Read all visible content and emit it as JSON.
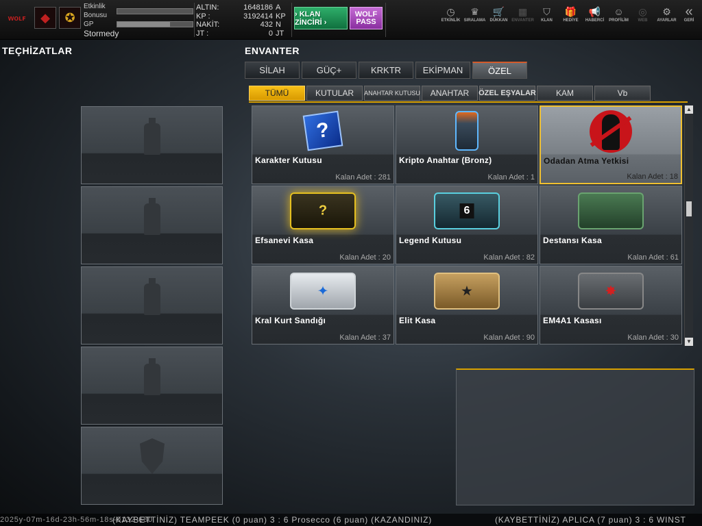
{
  "topbar": {
    "player": {
      "label_etkinlik": "Etkinlik",
      "label_bonus": "Bonusu",
      "label_gp": "GP",
      "name": "Stormedy",
      "gp_progress": 0.7
    },
    "currency": [
      {
        "key": "ALTIN:",
        "value": "1648186",
        "unit": "A"
      },
      {
        "key": "KP :",
        "value": "3192414",
        "unit": "KP"
      },
      {
        "key": "NAKİT:",
        "value": "432",
        "unit": "N"
      },
      {
        "key": "JT :",
        "value": "0",
        "unit": "JT"
      }
    ],
    "klan_button": "› KLAN ZİNCİRİ ›",
    "wolf_pass": [
      "WOLF",
      "PASS"
    ],
    "nav": [
      {
        "label": "ETKİNLİK",
        "icon": "stopwatch-icon",
        "glyph": "◷"
      },
      {
        "label": "SIRALAMA",
        "icon": "medal-icon",
        "glyph": "♛"
      },
      {
        "label": "DÜKKAN",
        "icon": "cart-icon",
        "glyph": "🛒"
      },
      {
        "label": "ENVANTER",
        "icon": "inventory-icon",
        "glyph": "▦"
      },
      {
        "label": "KLAN",
        "icon": "clan-shield-icon",
        "glyph": "⛉"
      },
      {
        "label": "HEDİYE",
        "icon": "gift-icon",
        "glyph": "🎁"
      },
      {
        "label": "HABERCİ",
        "icon": "megaphone-icon",
        "glyph": "📢"
      },
      {
        "label": "PROFİLİM",
        "icon": "profile-icon",
        "glyph": "☺"
      },
      {
        "label": "WEB",
        "icon": "globe-icon",
        "glyph": "◎"
      },
      {
        "label": "AYARLAR",
        "icon": "gear-icon",
        "glyph": "⚙"
      },
      {
        "label": "GERİ",
        "icon": "back-icon",
        "glyph": "«"
      }
    ]
  },
  "left": {
    "title": "TEÇHİZATLAR"
  },
  "inventory": {
    "title": "ENVANTER",
    "tabs": [
      "SİLAH",
      "GÜÇ+",
      "KRKTR",
      "EKİPMAN",
      "ÖZEL"
    ],
    "subtabs": [
      "TÜMÜ",
      "KUTULAR",
      "ANAHTAR KUTUSU",
      "ANAHTAR",
      "ÖZEL EŞYALAR",
      "KAM",
      "Vb"
    ],
    "items": [
      {
        "name": "Karakter Kutusu",
        "count": "Kalan Adet : 281"
      },
      {
        "name": "Kripto Anahtar (Bronz)",
        "count": "Kalan Adet : 1"
      },
      {
        "name": "Odadan Atma Yetkisi",
        "count": "Kalan Adet : 18"
      },
      {
        "name": "Efsanevi Kasa",
        "count": "Kalan Adet : 20"
      },
      {
        "name": "Legend Kutusu",
        "count": "Kalan Adet : 82"
      },
      {
        "name": "Destansı Kasa",
        "count": "Kalan Adet : 61"
      },
      {
        "name": "Kral Kurt Sandığı",
        "count": "Kalan Adet : 37"
      },
      {
        "name": "Elit Kasa",
        "count": "Kalan Adet : 90"
      },
      {
        "name": "EM4A1 Kasası",
        "count": "Kalan Adet : 30"
      }
    ]
  },
  "ticker": {
    "stamp": "2025y-07m-16d-23h-56m-18s-0132-680",
    "msg1": "(KAYBETTİNİZ) TEAMPEEK (0 puan) 3 : 6 Prosecco (6 puan) (KAZANDINIZ)",
    "msg2": "(KAYBETTİNİZ) APLICA (7 puan) 3 : 6 WINST"
  }
}
